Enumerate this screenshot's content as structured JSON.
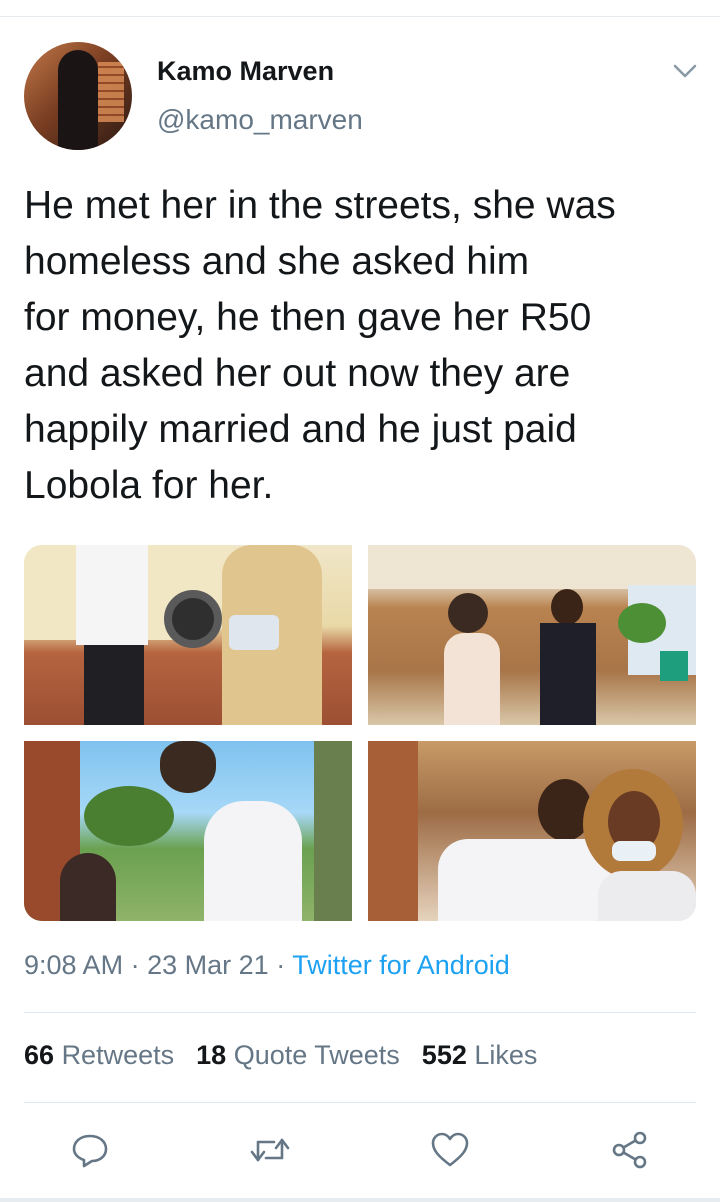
{
  "tweet": {
    "author_name": "Kamo Marven",
    "author_handle": "@kamo_marven",
    "text": "He met her in the streets, she was\nhomeless and she asked him\nfor money, he then gave her R50\nand asked her out now they are\nhappily married and he just paid\nLobola for her.",
    "time": "9:08 AM",
    "date": "23 Mar 21",
    "source": "Twitter for Android",
    "separator": "·"
  },
  "stats": {
    "retweets_count": "66",
    "retweets_label": "Retweets",
    "quotes_count": "18",
    "quotes_label": "Quote Tweets",
    "likes_count": "552",
    "likes_label": "Likes"
  },
  "icons": {
    "more": "chevron-down-icon",
    "reply": "reply-icon",
    "retweet": "retweet-icon",
    "like": "heart-icon",
    "share": "share-icon"
  },
  "colors": {
    "text": "#14171a",
    "secondary": "#657786",
    "link": "#1da1f2",
    "divider": "#e1e8ed"
  }
}
